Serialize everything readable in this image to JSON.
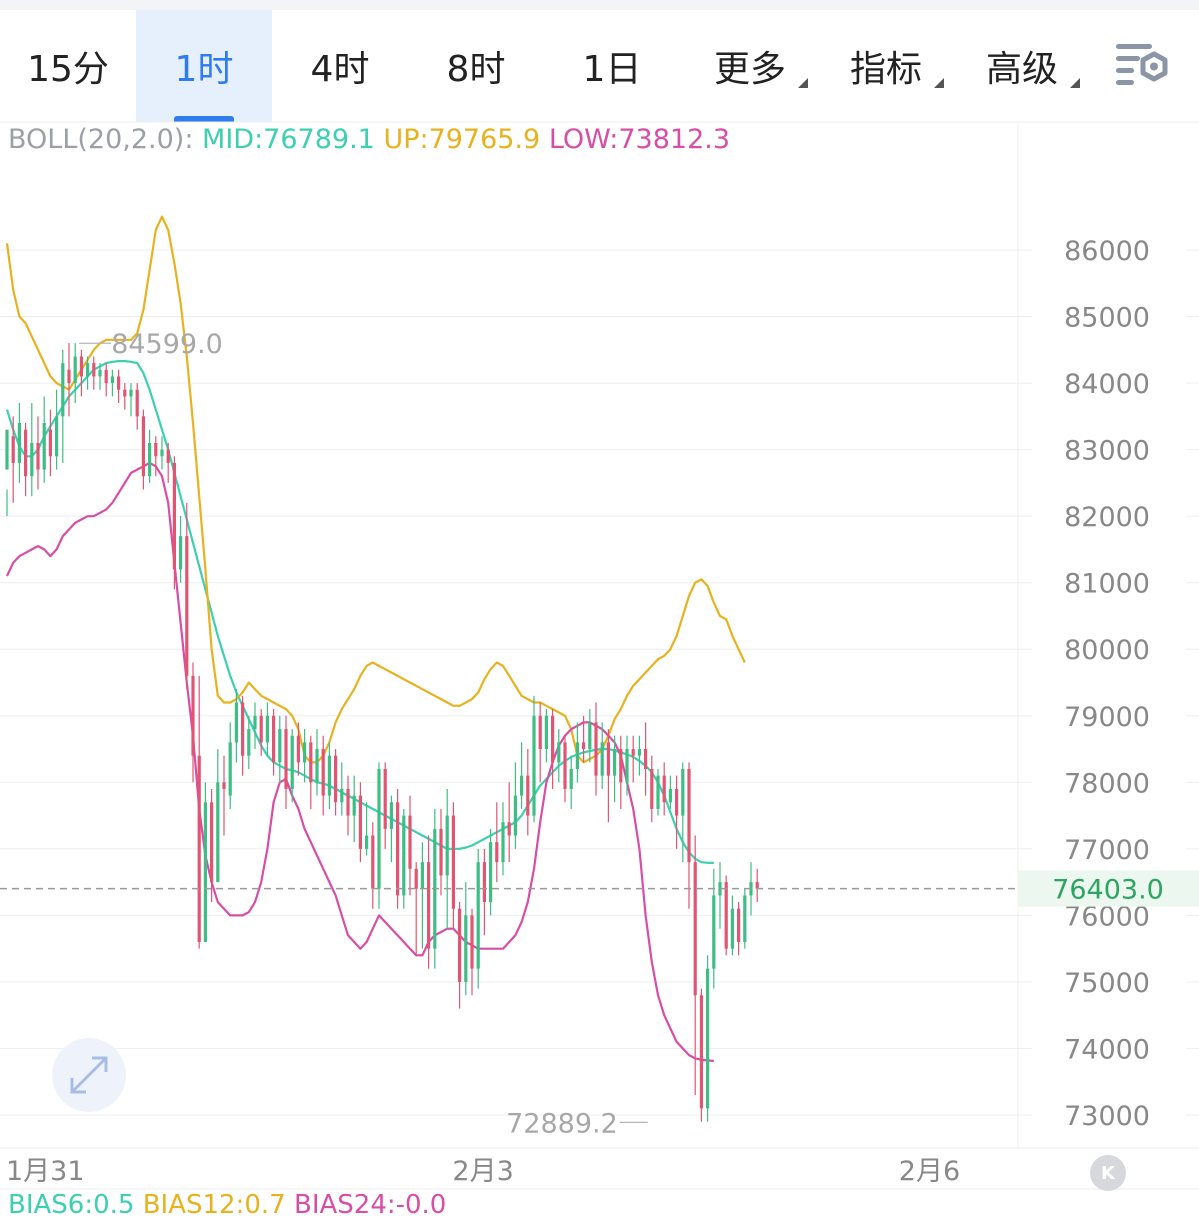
{
  "tabs": [
    {
      "label": "15分",
      "active": false,
      "dropdown": false
    },
    {
      "label": "1时",
      "active": true,
      "dropdown": false
    },
    {
      "label": "4时",
      "active": false,
      "dropdown": false
    },
    {
      "label": "8时",
      "active": false,
      "dropdown": false
    },
    {
      "label": "1日",
      "active": false,
      "dropdown": false
    },
    {
      "label": "更多",
      "active": false,
      "dropdown": true
    },
    {
      "label": "指标",
      "active": false,
      "dropdown": true
    },
    {
      "label": "高级",
      "active": false,
      "dropdown": true
    }
  ],
  "settings_icon": "chart-settings-icon",
  "expand_icon": "expand-arrows-icon",
  "scroll_icon": "scroll-to-latest-icon",
  "scroll_glyph": "K",
  "legend": {
    "name": "BOLL(20,2.0):",
    "mid": "MID:76789.1",
    "up": "UP:79765.9",
    "low": "LOW:73812.3"
  },
  "bias": {
    "b6": "BIAS6:0.5",
    "b12": "BIAS12:0.7",
    "b24": "BIAS24:-0.0"
  },
  "colors": {
    "up": "#3ebd84",
    "down": "#e05572",
    "mid": "#3ccfb0",
    "upper": "#e8b21f",
    "lower": "#d84ea6",
    "grid": "#eeeeee",
    "axis_text": "#888888",
    "accent": "#2f7cf0"
  },
  "chart_data": {
    "type": "candlestick",
    "title": "",
    "xlabel": "",
    "ylabel": "",
    "ylim": [
      72350,
      87300
    ],
    "y_ticks": [
      73000,
      74000,
      75000,
      76000,
      77000,
      78000,
      79000,
      80000,
      81000,
      82000,
      83000,
      84000,
      85000,
      86000
    ],
    "x_ticks": [
      {
        "label": "1月31",
        "index": 0
      },
      {
        "label": "2月3",
        "index": 72
      },
      {
        "label": "2月6",
        "index": 144
      }
    ],
    "grid": true,
    "current_price": {
      "value": 76403.0,
      "label": "76403.0"
    },
    "annotations": [
      {
        "label": "84599.0",
        "value": 84599.0,
        "index": 11
      },
      {
        "label": "72889.2",
        "value": 72889.2,
        "index": 104
      }
    ],
    "candles": [
      [
        82700,
        83300,
        82400,
        82000
      ],
      [
        83200,
        82800,
        83500,
        82200
      ],
      [
        82800,
        83400,
        83700,
        82500
      ],
      [
        83300,
        82600,
        83400,
        82300
      ],
      [
        82600,
        83100,
        83700,
        82300
      ],
      [
        83100,
        82700,
        83500,
        82400
      ],
      [
        82700,
        83400,
        83800,
        82500
      ],
      [
        83300,
        82900,
        83600,
        82600
      ],
      [
        82900,
        83500,
        83900,
        82700
      ],
      [
        83500,
        84300,
        84500,
        82800
      ],
      [
        84200,
        84000,
        84600,
        83500
      ],
      [
        84000,
        84400,
        84600,
        83700
      ],
      [
        84400,
        84100,
        84500,
        83800
      ],
      [
        84100,
        84300,
        84400,
        83900
      ],
      [
        84300,
        84100,
        84400,
        83900
      ],
      [
        84100,
        84200,
        84300,
        83900
      ],
      [
        84200,
        84000,
        84300,
        83800
      ],
      [
        84000,
        84100,
        84200,
        83800
      ],
      [
        84100,
        83900,
        84200,
        83700
      ],
      [
        83900,
        83800,
        84000,
        83600
      ],
      [
        83800,
        83900,
        84000,
        83500
      ],
      [
        83900,
        83500,
        84000,
        83300
      ],
      [
        83500,
        82600,
        83600,
        82400
      ],
      [
        82600,
        83100,
        83300,
        82500
      ],
      [
        83100,
        82900,
        83200,
        82600
      ],
      [
        82900,
        83000,
        83200,
        82700
      ],
      [
        83000,
        82800,
        83100,
        82500
      ],
      [
        82800,
        81200,
        82900,
        80900
      ],
      [
        81200,
        81700,
        82000,
        81000
      ],
      [
        81700,
        79600,
        82200,
        79400
      ],
      [
        79600,
        78400,
        79800,
        78000
      ],
      [
        78400,
        75600,
        79600,
        75500
      ],
      [
        75600,
        77700,
        78000,
        77300
      ],
      [
        77700,
        76500,
        77900,
        76200
      ],
      [
        76500,
        78000,
        78500,
        77800
      ],
      [
        78000,
        77900,
        78400,
        77200
      ],
      [
        77800,
        78600,
        78900,
        77600
      ],
      [
        78600,
        79200,
        79400,
        78300
      ],
      [
        79200,
        78400,
        79300,
        78100
      ],
      [
        78400,
        78800,
        79000,
        78200
      ],
      [
        78800,
        79000,
        79200,
        78500
      ],
      [
        79000,
        78600,
        79100,
        78400
      ],
      [
        78600,
        79000,
        79200,
        78400
      ],
      [
        79000,
        78300,
        79100,
        78100
      ],
      [
        78300,
        78800,
        79000,
        78000
      ],
      [
        78800,
        77900,
        79000,
        77600
      ],
      [
        77900,
        78700,
        78800,
        77700
      ],
      [
        78700,
        78300,
        78900,
        78100
      ],
      [
        78300,
        78600,
        78800,
        78000
      ],
      [
        78600,
        78000,
        78700,
        77600
      ],
      [
        78000,
        78500,
        78800,
        77800
      ],
      [
        78500,
        77800,
        78700,
        77500
      ],
      [
        77800,
        78400,
        78600,
        77600
      ],
      [
        78400,
        77700,
        78500,
        77500
      ],
      [
        77700,
        77900,
        78300,
        77500
      ],
      [
        77900,
        77500,
        78100,
        77200
      ],
      [
        77500,
        77800,
        78100,
        77100
      ],
      [
        77800,
        77000,
        78000,
        76800
      ],
      [
        77000,
        77200,
        77700,
        76900
      ],
      [
        77200,
        76400,
        77400,
        76100
      ],
      [
        76400,
        78200,
        78300,
        76100
      ],
      [
        78200,
        77300,
        78300,
        77000
      ],
      [
        77300,
        77700,
        77800,
        76800
      ],
      [
        77700,
        76300,
        77900,
        76100
      ],
      [
        76300,
        77500,
        77600,
        76100
      ],
      [
        77500,
        76700,
        77800,
        76300
      ],
      [
        76700,
        76400,
        76800,
        75400
      ],
      [
        76400,
        76800,
        77100,
        75500
      ],
      [
        76800,
        75500,
        77200,
        75200
      ],
      [
        75500,
        77300,
        77600,
        75200
      ],
      [
        77300,
        76600,
        77600,
        76300
      ],
      [
        76600,
        77500,
        77900,
        75800
      ],
      [
        77500,
        76100,
        77700,
        75800
      ],
      [
        76100,
        75000,
        76200,
        74600
      ],
      [
        75000,
        76000,
        76500,
        74800
      ],
      [
        76000,
        75200,
        76100,
        74800
      ],
      [
        75200,
        76800,
        77000,
        74900
      ],
      [
        76800,
        76200,
        77000,
        75700
      ],
      [
        76200,
        77100,
        77300,
        76000
      ],
      [
        77100,
        76800,
        77700,
        76500
      ],
      [
        76800,
        77400,
        77700,
        76600
      ],
      [
        77400,
        77200,
        78000,
        76800
      ],
      [
        77200,
        77800,
        78300,
        77000
      ],
      [
        77800,
        78100,
        78600,
        77600
      ],
      [
        78100,
        77500,
        78500,
        77200
      ],
      [
        77500,
        79000,
        79300,
        77400
      ],
      [
        79000,
        78500,
        79200,
        78000
      ],
      [
        78500,
        79000,
        79100,
        78300
      ],
      [
        79000,
        78300,
        79100,
        77900
      ],
      [
        78300,
        78600,
        78800,
        78000
      ],
      [
        78600,
        77900,
        78700,
        77700
      ],
      [
        77900,
        78200,
        78400,
        77600
      ],
      [
        78200,
        78600,
        78900,
        78000
      ],
      [
        78600,
        78500,
        79000,
        78300
      ],
      [
        78500,
        78900,
        79100,
        78300
      ],
      [
        78900,
        78100,
        79200,
        77800
      ],
      [
        78100,
        78600,
        78900,
        77900
      ],
      [
        78600,
        78100,
        78800,
        77400
      ],
      [
        78100,
        78500,
        78700,
        77700
      ],
      [
        78500,
        78000,
        78700,
        77600
      ],
      [
        78000,
        78500,
        78700,
        77800
      ],
      [
        78500,
        78400,
        78700,
        78000
      ],
      [
        78400,
        78500,
        78700,
        78100
      ],
      [
        78500,
        78200,
        78900,
        77800
      ],
      [
        78200,
        77600,
        78400,
        77400
      ],
      [
        77600,
        78100,
        78200,
        77500
      ],
      [
        78100,
        77700,
        78300,
        77500
      ],
      [
        77700,
        77900,
        78100,
        77600
      ],
      [
        77900,
        77500,
        78100,
        77000
      ],
      [
        77500,
        78200,
        78300,
        76800
      ],
      [
        78200,
        76800,
        78300,
        76100
      ],
      [
        76800,
        74800,
        77200,
        73300
      ],
      [
        74800,
        73100,
        74900,
        72900
      ],
      [
        73100,
        75200,
        75400,
        72900
      ],
      [
        75200,
        76300,
        76700,
        74900
      ],
      [
        76300,
        76500,
        76800,
        75800
      ],
      [
        76500,
        75500,
        76600,
        75400
      ],
      [
        75500,
        76100,
        76300,
        75400
      ],
      [
        76100,
        75600,
        76200,
        75400
      ],
      [
        75600,
        76300,
        76400,
        75500
      ],
      [
        76300,
        76500,
        76800,
        76000
      ],
      [
        76500,
        76400,
        76700,
        76200
      ]
    ],
    "series": [
      {
        "name": "MID",
        "values": [
          83600,
          83300,
          83050,
          82900,
          82900,
          83000,
          83200,
          83350,
          83500,
          83650,
          83800,
          83900,
          84000,
          84100,
          84200,
          84250,
          84300,
          84320,
          84330,
          84330,
          84320,
          84300,
          84150,
          83900,
          83600,
          83300,
          83000,
          82650,
          82300,
          81950,
          81600,
          81250,
          80900,
          80550,
          80200,
          79900,
          79600,
          79350,
          79150,
          78950,
          78750,
          78550,
          78400,
          78300,
          78250,
          78200,
          78180,
          78150,
          78100,
          78050,
          78000,
          77980,
          77950,
          77900,
          77850,
          77800,
          77750,
          77700,
          77650,
          77600,
          77550,
          77500,
          77450,
          77400,
          77350,
          77300,
          77250,
          77200,
          77150,
          77100,
          77050,
          77000,
          77000,
          77000,
          77020,
          77050,
          77100,
          77150,
          77200,
          77250,
          77300,
          77350,
          77400,
          77500,
          77650,
          77800,
          77950,
          78050,
          78150,
          78250,
          78320,
          78380,
          78420,
          78450,
          78470,
          78490,
          78500,
          78500,
          78480,
          78450,
          78420,
          78380,
          78320,
          78250,
          78150,
          78000,
          77800,
          77550,
          77300,
          77100,
          76950,
          76850,
          76800,
          76790,
          76789
        ]
      },
      {
        "name": "UP",
        "values": [
          86100,
          85400,
          85000,
          84900,
          84700,
          84500,
          84300,
          84100,
          84000,
          83950,
          83900,
          84050,
          84200,
          84350,
          84500,
          84600,
          84650,
          84650,
          84650,
          84650,
          84650,
          84750,
          85100,
          85700,
          86300,
          86500,
          86300,
          85800,
          85200,
          84400,
          83400,
          82300,
          81200,
          80000,
          79300,
          79200,
          79200,
          79250,
          79350,
          79500,
          79400,
          79300,
          79250,
          79200,
          79150,
          79100,
          79000,
          78800,
          78400,
          78300,
          78300,
          78400,
          78600,
          78900,
          79100,
          79250,
          79400,
          79600,
          79750,
          79800,
          79750,
          79700,
          79650,
          79600,
          79550,
          79500,
          79450,
          79400,
          79350,
          79300,
          79250,
          79200,
          79150,
          79150,
          79200,
          79250,
          79350,
          79550,
          79700,
          79800,
          79750,
          79600,
          79450,
          79300,
          79250,
          79200,
          79200,
          79150,
          79100,
          79050,
          79000,
          78800,
          78400,
          78300,
          78350,
          78400,
          78500,
          78700,
          78950,
          79100,
          79300,
          79450,
          79550,
          79650,
          79750,
          79850,
          79900,
          80000,
          80200,
          80500,
          80800,
          81000,
          81050,
          80950,
          80700,
          80500,
          80450,
          80200,
          80000,
          79800
        ]
      },
      {
        "name": "LOW",
        "values": [
          81100,
          81300,
          81400,
          81450,
          81500,
          81550,
          81500,
          81400,
          81500,
          81700,
          81800,
          81900,
          81950,
          82000,
          82000,
          82050,
          82100,
          82200,
          82350,
          82500,
          82650,
          82700,
          82750,
          82800,
          82750,
          82600,
          82200,
          81300,
          80400,
          79500,
          78700,
          77600,
          76900,
          76500,
          76200,
          76100,
          76000,
          76000,
          76000,
          76050,
          76200,
          76500,
          77000,
          77700,
          78000,
          78050,
          77800,
          77600,
          77300,
          77100,
          76900,
          76700,
          76500,
          76300,
          76000,
          75700,
          75600,
          75500,
          75600,
          75800,
          76000,
          75900,
          75800,
          75700,
          75600,
          75500,
          75400,
          75400,
          75600,
          75700,
          75750,
          75800,
          75800,
          75700,
          75600,
          75550,
          75500,
          75500,
          75500,
          75500,
          75500,
          75600,
          75700,
          75900,
          76200,
          76700,
          77400,
          78000,
          78300,
          78550,
          78700,
          78800,
          78850,
          78900,
          78900,
          78850,
          78800,
          78700,
          78600,
          78400,
          78000,
          77600,
          77000,
          76000,
          75300,
          74800,
          74500,
          74300,
          74100,
          74000,
          73900,
          73850,
          73830,
          73820,
          73812
        ]
      }
    ]
  }
}
